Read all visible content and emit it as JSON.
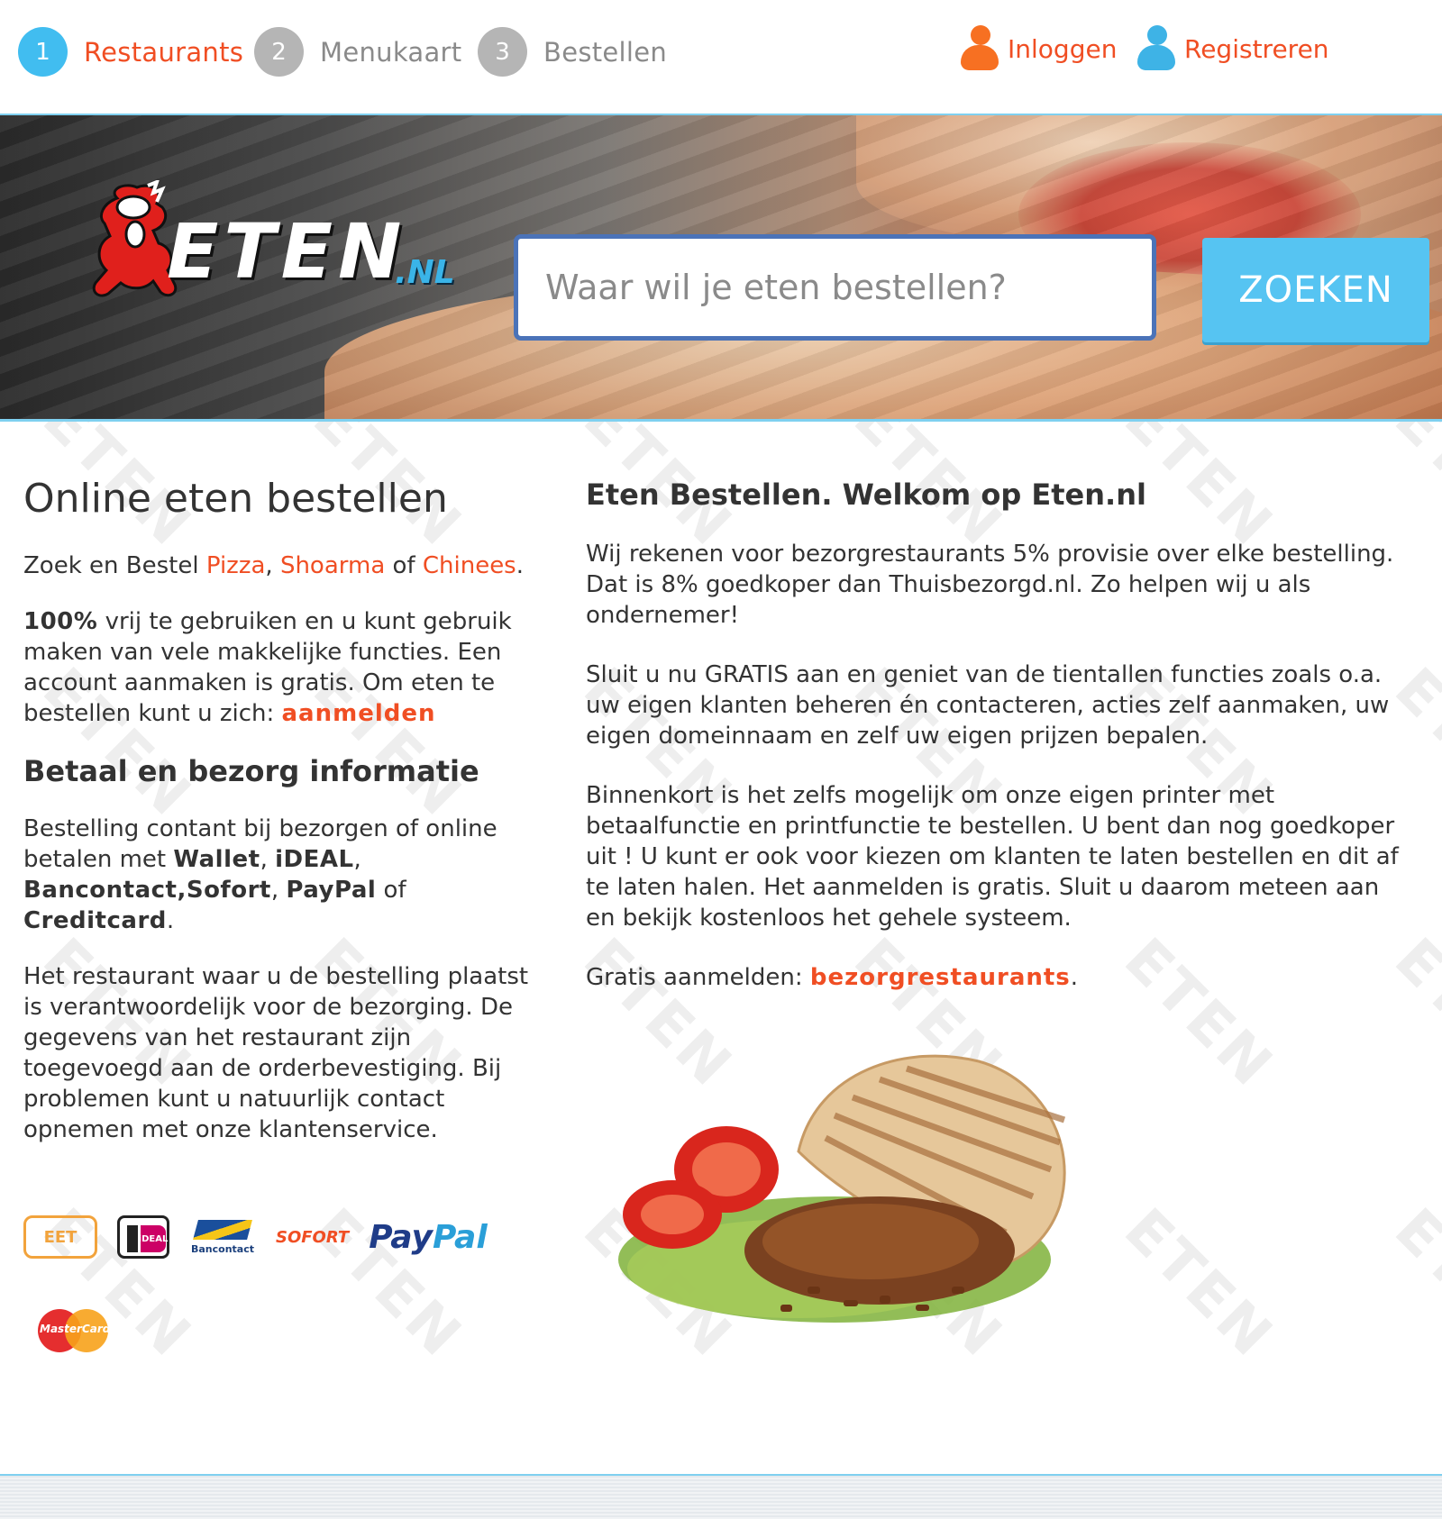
{
  "steps": [
    {
      "number": "1",
      "label": "Restaurants",
      "active": true
    },
    {
      "number": "2",
      "label": "Menukaart",
      "active": false
    },
    {
      "number": "3",
      "label": "Bestellen",
      "active": false
    }
  ],
  "account": {
    "login_label": "Inloggen",
    "register_label": "Registreren"
  },
  "logo": {
    "text": "ETEN",
    "tld": ".NL"
  },
  "search": {
    "placeholder": "Waar wil je eten bestellen?",
    "button_label": "ZOEKEN"
  },
  "watermark_text": "ETEN",
  "left": {
    "title": "Online eten bestellen",
    "intro": {
      "prefix": "Zoek en Bestel ",
      "link1": "Pizza",
      "sep1": ", ",
      "link2": "Shoarma",
      "sep2": " of ",
      "link3": "Chinees",
      "suffix": "."
    },
    "free": {
      "bold": "100%",
      "text": " vrij te gebruiken en u kunt gebruik maken van vele makkelijke functies. Een account aanmaken is gratis. Om eten te bestellen kunt u zich: ",
      "link": "aanmelden"
    },
    "pay_heading": "Betaal en bezorg informatie",
    "pay": {
      "text1": "Bestelling contant bij bezorgen of online betalen met ",
      "b1": "Wallet",
      "s1": ", ",
      "b2": "iDEAL",
      "s2": ", ",
      "b3": "Bancontact,Sofort",
      "s3": ", ",
      "b4": "PayPal",
      "s4": " of ",
      "b5": "Creditcard",
      "s5": "."
    },
    "delivery_text": "Het restaurant waar u de bestelling plaatst is verantwoordelijk voor de bezorging. De gegevens van het restaurant zijn toegevoegd aan de orderbevestiging. Bij problemen kunt u natuurlijk contact opnemen met onze klantenservice.",
    "payment_logos": {
      "wallet": "EET",
      "ideal": "iDEAL",
      "bancontact": "Bancontact",
      "sofort": "SOFORT",
      "paypal_a": "Pay",
      "paypal_b": "Pal",
      "mastercard": "MasterCard"
    }
  },
  "right": {
    "heading": "Eten Bestellen. Welkom op Eten.nl",
    "p1": "Wij rekenen voor bezorgrestaurants 5% provisie over elke bestelling. Dat is 8% goedkoper dan Thuisbezorgd.nl. Zo helpen wij u als ondernemer!",
    "p2": "Sluit u nu GRATIS aan en geniet van de tientallen functies zoals o.a. uw eigen klanten beheren én contacteren, acties zelf aanmaken, uw eigen domeinnaam en zelf uw eigen prijzen bepalen.",
    "p3": "Binnenkort is het zelfs mogelijk om onze eigen printer met betaalfunctie en printfunctie te bestellen. U bent dan nog goedkoper uit ! U kunt er ook voor kiezen om klanten te laten bestellen en dit af te laten halen. Het aanmelden is gratis. Sluit u daarom meteen aan en bekijk kostenloos het gehele systeem.",
    "signup_prefix": "Gratis aanmelden: ",
    "signup_link": "bezorgrestaurants",
    "signup_suffix": "."
  },
  "colors": {
    "accent": "#f04e23",
    "step_active": "#41bdf0",
    "step_inactive": "#b5b5b5",
    "search_button": "#56c4f2",
    "search_border": "#4b73b8"
  }
}
